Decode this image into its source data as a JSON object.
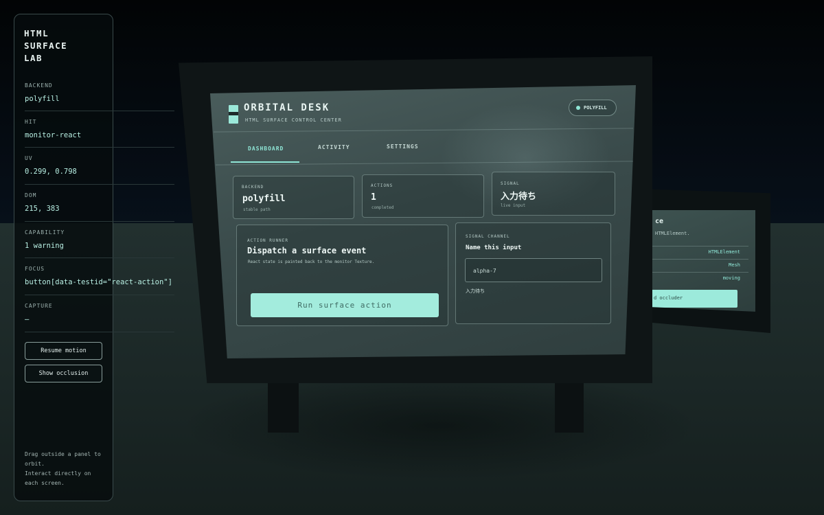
{
  "side_panel": {
    "title_lines": [
      "HTML",
      "SURFACE",
      "LAB"
    ],
    "fields": [
      {
        "label": "BACKEND",
        "value": "polyfill"
      },
      {
        "label": "HIT",
        "value": "monitor-react"
      },
      {
        "label": "UV",
        "value": "0.299, 0.798"
      },
      {
        "label": "DOM",
        "value": "215, 383"
      },
      {
        "label": "CAPABILITY",
        "value": "1 warning"
      },
      {
        "label": "FOCUS",
        "value": "button[data-testid=\"react-action\"]"
      },
      {
        "label": "CAPTURE",
        "value": "—"
      }
    ],
    "buttons": {
      "resume": "Resume motion",
      "occlusion": "Show occlusion"
    },
    "hint_lines": [
      "Drag outside a panel to",
      "orbit.",
      "Interact directly on",
      "each screen."
    ]
  },
  "monitor": {
    "app_title": "ORBITAL DESK",
    "app_subtitle": "HTML SURFACE CONTROL CENTER",
    "status_pill": "POLYFILL",
    "tabs": [
      "DASHBOARD",
      "ACTIVITY",
      "SETTINGS"
    ],
    "active_tab": "DASHBOARD",
    "stats": [
      {
        "label": "BACKEND",
        "value": "polyfill",
        "note": "stable path"
      },
      {
        "label": "ACTIONS",
        "value": "1",
        "note": "completed"
      },
      {
        "label": "SIGNAL",
        "value": "入力待ち",
        "note": "live input"
      }
    ],
    "action_runner": {
      "label": "ACTION RUNNER",
      "title": "Dispatch a surface event",
      "description": "React state is painted back to the monitor Texture.",
      "button": "Run surface action"
    },
    "signal_channel": {
      "label": "SIGNAL CHANNEL",
      "title": "Name this input",
      "input_value": "alpha-7",
      "echo": "入力待ち"
    }
  },
  "secondary_monitor": {
    "title_fragment": "ce",
    "subtitle_fragment": "HTMLElement.",
    "rows": [
      "HTMLElement",
      "Mesh",
      "moving"
    ],
    "button_fragment": "d occluder"
  },
  "colors": {
    "accent": "#8fe6d6",
    "button_fill": "#a3ecdd",
    "background": "#05090b"
  }
}
